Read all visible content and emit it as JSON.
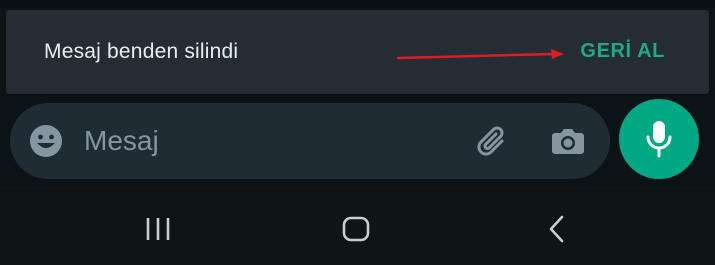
{
  "snackbar": {
    "message": "Mesaj benden silindi",
    "action_label": "GERİ AL"
  },
  "composer": {
    "placeholder": "Mesaj",
    "icons": {
      "emoji": "emoji-icon",
      "attach": "paperclip-icon",
      "camera": "camera-icon",
      "mic": "mic-icon"
    }
  },
  "nav_bar": {
    "icons": [
      "recent-apps-icon",
      "home-icon",
      "back-icon"
    ]
  },
  "colors": {
    "snackbar_bg": "#232d33",
    "action_accent": "#21a884",
    "composer_bg": "#1f2c33",
    "mic_button": "#00a884",
    "annotation_arrow": "#e01b24"
  }
}
